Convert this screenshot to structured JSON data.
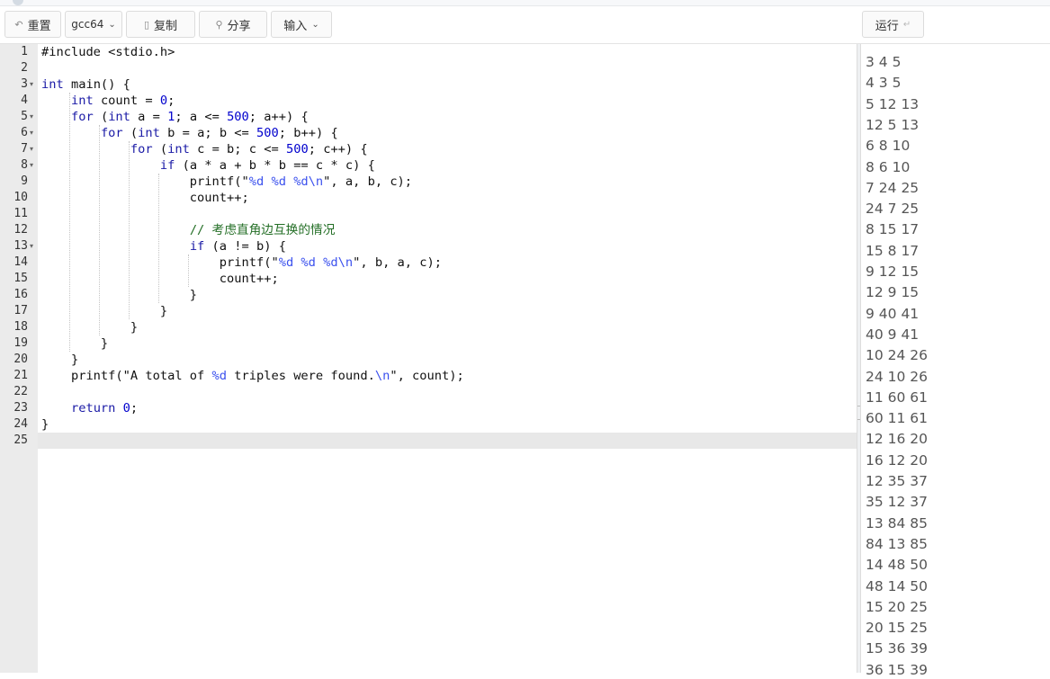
{
  "toolbar": {
    "reset_label": "重置",
    "compiler_label": "gcc64",
    "copy_label": "复制",
    "share_label": "分享",
    "input_label": "输入",
    "run_label": "运行",
    "run_shortcut_glyph": "↵"
  },
  "editor": {
    "active_line": 25,
    "lines": [
      {
        "num": "1",
        "fold": false
      },
      {
        "num": "2",
        "fold": false
      },
      {
        "num": "3",
        "fold": true
      },
      {
        "num": "4",
        "fold": false
      },
      {
        "num": "5",
        "fold": true
      },
      {
        "num": "6",
        "fold": true
      },
      {
        "num": "7",
        "fold": true
      },
      {
        "num": "8",
        "fold": true
      },
      {
        "num": "9",
        "fold": false
      },
      {
        "num": "10",
        "fold": false
      },
      {
        "num": "11",
        "fold": false
      },
      {
        "num": "12",
        "fold": false
      },
      {
        "num": "13",
        "fold": true
      },
      {
        "num": "14",
        "fold": false
      },
      {
        "num": "15",
        "fold": false
      },
      {
        "num": "16",
        "fold": false
      },
      {
        "num": "17",
        "fold": false
      },
      {
        "num": "18",
        "fold": false
      },
      {
        "num": "19",
        "fold": false
      },
      {
        "num": "20",
        "fold": false
      },
      {
        "num": "21",
        "fold": false
      },
      {
        "num": "22",
        "fold": false
      },
      {
        "num": "23",
        "fold": false
      },
      {
        "num": "24",
        "fold": false
      },
      {
        "num": "25",
        "fold": false
      }
    ],
    "code": [
      [
        [
          "p",
          "#include <stdio.h>"
        ]
      ],
      [],
      [
        [
          "k",
          "int"
        ],
        [
          "p",
          " main() {"
        ]
      ],
      [
        [
          "p",
          "    "
        ],
        [
          "k",
          "int"
        ],
        [
          "p",
          " count = "
        ],
        [
          "n",
          "0"
        ],
        [
          "p",
          ";"
        ]
      ],
      [
        [
          "p",
          "    "
        ],
        [
          "k",
          "for"
        ],
        [
          "p",
          " ("
        ],
        [
          "k",
          "int"
        ],
        [
          "p",
          " a = "
        ],
        [
          "n",
          "1"
        ],
        [
          "p",
          "; a <= "
        ],
        [
          "n",
          "500"
        ],
        [
          "p",
          "; a++) {"
        ]
      ],
      [
        [
          "p",
          "        "
        ],
        [
          "k",
          "for"
        ],
        [
          "p",
          " ("
        ],
        [
          "k",
          "int"
        ],
        [
          "p",
          " b = a; b <= "
        ],
        [
          "n",
          "500"
        ],
        [
          "p",
          "; b++) {"
        ]
      ],
      [
        [
          "p",
          "            "
        ],
        [
          "k",
          "for"
        ],
        [
          "p",
          " ("
        ],
        [
          "k",
          "int"
        ],
        [
          "p",
          " c = b; c <= "
        ],
        [
          "n",
          "500"
        ],
        [
          "p",
          "; c++) {"
        ]
      ],
      [
        [
          "p",
          "                "
        ],
        [
          "k",
          "if"
        ],
        [
          "p",
          " (a * a + b * b == c * c) {"
        ]
      ],
      [
        [
          "p",
          "                    printf(\""
        ],
        [
          "f",
          "%d %d %d\\n"
        ],
        [
          "p",
          "\", a, b, c);"
        ]
      ],
      [
        [
          "p",
          "                    count++;"
        ]
      ],
      [],
      [
        [
          "p",
          "                    "
        ],
        [
          "c",
          "// 考虑直角边互换的情况"
        ]
      ],
      [
        [
          "p",
          "                    "
        ],
        [
          "k",
          "if"
        ],
        [
          "p",
          " (a != b) {"
        ]
      ],
      [
        [
          "p",
          "                        printf(\""
        ],
        [
          "f",
          "%d %d %d\\n"
        ],
        [
          "p",
          "\", b, a, c);"
        ]
      ],
      [
        [
          "p",
          "                        count++;"
        ]
      ],
      [
        [
          "p",
          "                    }"
        ]
      ],
      [
        [
          "p",
          "                }"
        ]
      ],
      [
        [
          "p",
          "            }"
        ]
      ],
      [
        [
          "p",
          "        }"
        ]
      ],
      [
        [
          "p",
          "    }"
        ]
      ],
      [
        [
          "p",
          "    printf(\"A total of "
        ],
        [
          "f",
          "%d"
        ],
        [
          "p",
          " triples were found."
        ],
        [
          "f",
          "\\n"
        ],
        [
          "p",
          "\", count);"
        ]
      ],
      [],
      [
        [
          "p",
          "    "
        ],
        [
          "k",
          "return"
        ],
        [
          "p",
          " "
        ],
        [
          "n",
          "0"
        ],
        [
          "p",
          ";"
        ]
      ],
      [
        [
          "p",
          "}"
        ]
      ],
      []
    ]
  },
  "output": {
    "lines": [
      "3 4 5",
      "4 3 5",
      "5 12 13",
      "12 5 13",
      "6 8 10",
      "8 6 10",
      "7 24 25",
      "24 7 25",
      "8 15 17",
      "15 8 17",
      "9 12 15",
      "12 9 15",
      "9 40 41",
      "40 9 41",
      "10 24 26",
      "24 10 26",
      "11 60 61",
      "60 11 61",
      "12 16 20",
      "16 12 20",
      "12 35 37",
      "35 12 37",
      "13 84 85",
      "84 13 85",
      "14 48 50",
      "48 14 50",
      "15 20 25",
      "20 15 25",
      "15 36 39",
      "36 15 39"
    ]
  }
}
